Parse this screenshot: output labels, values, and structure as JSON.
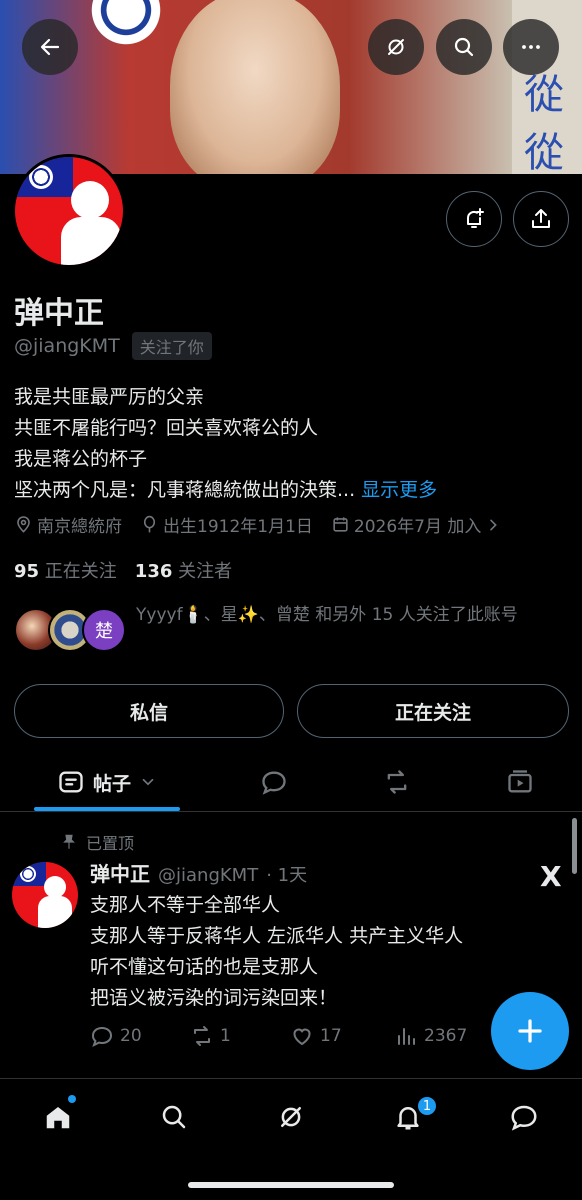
{
  "profile": {
    "name": "弹中正",
    "handle": "@jiangKMT",
    "follows_you": "关注了你",
    "bio_lines": [
      "我是共匪最严厉的父亲",
      "共匪不屠能行吗？回关喜欢蒋公的人",
      "我是蒋公的杯子",
      "坚决两个凡是：凡事蒋總統做出的決策..."
    ],
    "show_more": "显示更多",
    "location": "南京總統府",
    "birth": "出生1912年1月1日",
    "joined": "2026年7月 加入",
    "following_count": "95",
    "following_label": "正在关注",
    "followers_count": "136",
    "followers_label": "关注者",
    "known_followers": "Yyyyf🕯️、星✨、曾楚 和另外 15 人关注了此账号",
    "message_button": "私信",
    "following_button": "正在关注"
  },
  "banner": {
    "chars": [
      "從",
      "從"
    ]
  },
  "tabs": {
    "posts_label": "帖子"
  },
  "post": {
    "pinned_label": "已置顶",
    "author_name": "弹中正",
    "author_handle": "@jiangKMT",
    "time": "· 1天",
    "x_mark": "X",
    "lines": [
      "支那人不等于全部华人",
      "支那人等于反蒋华人 左派华人 共产主义华人",
      "听不懂这句话的也是支那人",
      "把语义被污染的词污染回来！"
    ],
    "replies": "20",
    "reposts": "1",
    "likes": "17",
    "views": "2367"
  },
  "mini_avatar_label": "楚",
  "nav": {
    "notifications_badge": "1"
  },
  "colors": {
    "accent": "#1d9bf0",
    "background": "#000000",
    "text": "#e7e9ea",
    "muted": "#71767b",
    "border": "#536471"
  },
  "icons": {
    "back": "arrow-left-icon",
    "grok": "grok-icon",
    "search": "search-icon",
    "more": "more-icon",
    "notify": "bell-plus-icon",
    "share": "share-icon"
  }
}
